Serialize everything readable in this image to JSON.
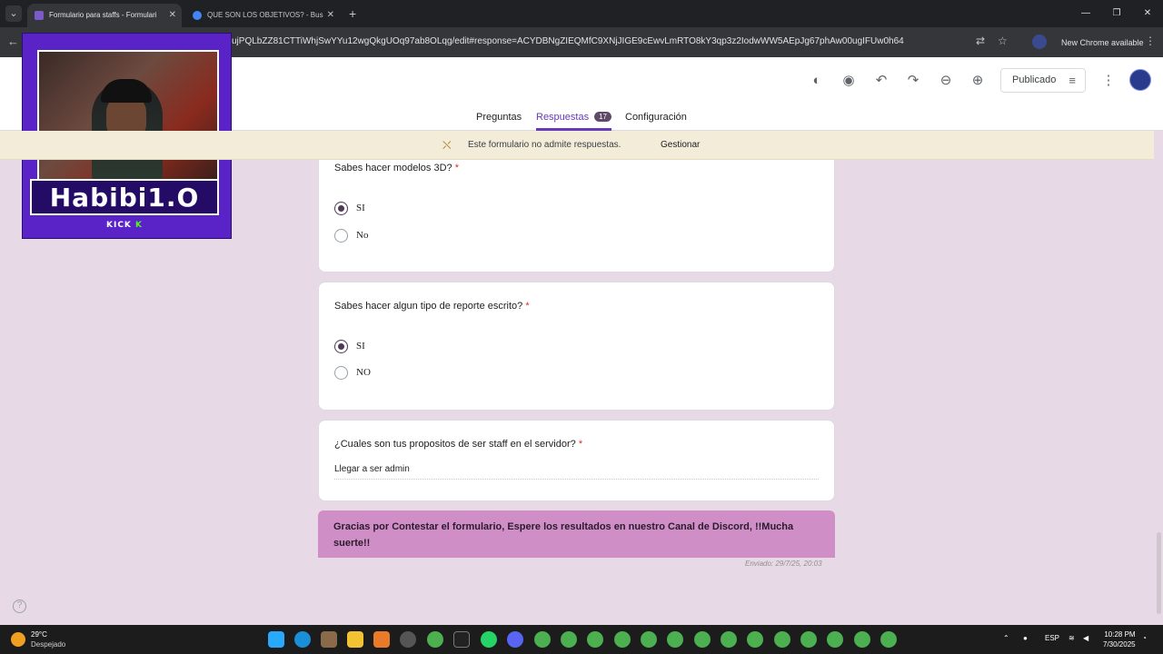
{
  "browser": {
    "tabs": [
      {
        "title": "Formulario para staffs - Formulari",
        "active": true,
        "favicon_color": "#7b5cc7"
      },
      {
        "title": "QUE SON LOS OBJETIVOS? - Busc",
        "active": false,
        "favicon_color": "#4285f4"
      }
    ],
    "new_tab": "+",
    "url": "ujPQLbZZ81CTTiWhjSwYYu12wgQkgUOq97ab8OLqg/edit#response=ACYDBNgZIEQMfC9XNjJIGE9cEwvLmRTO8kY3qp3z2IodwWW5AEpJg67phAw00ugIFUw0h64",
    "new_chrome": "New Chrome available"
  },
  "forms": {
    "publish_label": "Publicado",
    "tabs": {
      "questions": "Preguntas",
      "responses": "Respuestas",
      "responses_count": "17",
      "settings": "Configuración"
    },
    "banner": {
      "message": "Este formulario no admite respuestas.",
      "action": "Gestionar"
    },
    "questions": [
      {
        "title": "Sabes hacer modelos 3D?",
        "required": "*",
        "options": [
          {
            "label": "SI",
            "selected": true
          },
          {
            "label": "No",
            "selected": false
          }
        ]
      },
      {
        "title": "Sabes hacer algun tipo de reporte escrito?",
        "required": "*",
        "options": [
          {
            "label": "SI",
            "selected": true
          },
          {
            "label": "NO",
            "selected": false
          }
        ]
      },
      {
        "title": "¿Cuales son tus propositos de ser staff en el servidor?",
        "required": "*",
        "answer": "Llegar a ser admin"
      }
    ],
    "thanks_message": "Gracias por Contestar el formulario, Espere los resultados en nuestro Canal de Discord, !!Mucha suerte!!",
    "sent": "Enviado: 29/7/25, 20:03"
  },
  "overlay": {
    "name": "Habibi1.O",
    "platform": "KICK",
    "platform_glyph": "K"
  },
  "taskbar": {
    "temp": "29°C",
    "weather": "Despejado",
    "lang": "ESP",
    "time": "10:28 PM",
    "date": "7/30/2025"
  }
}
